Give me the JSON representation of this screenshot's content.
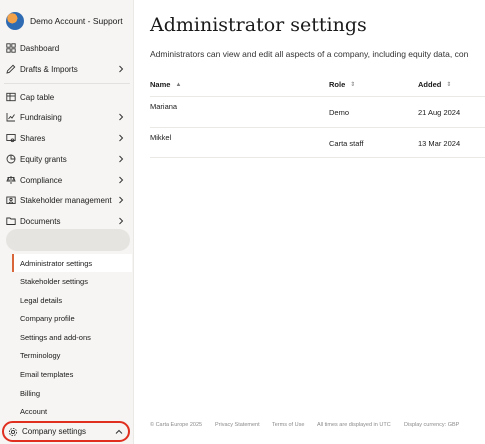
{
  "account": {
    "name": "Demo Account - Support"
  },
  "nav": {
    "dashboard": "Dashboard",
    "drafts": "Drafts & Imports",
    "cap_table": "Cap table",
    "fundraising": "Fundraising",
    "shares": "Shares",
    "equity_grants": "Equity grants",
    "compliance": "Compliance",
    "stakeholder_management": "Stakeholder management",
    "documents": "Documents"
  },
  "settings_menu": {
    "administrator": "Administrator settings",
    "stakeholder": "Stakeholder settings",
    "legal": "Legal details",
    "company_profile": "Company profile",
    "addons": "Settings and add-ons",
    "terminology": "Terminology",
    "email_templates": "Email templates",
    "billing": "Billing",
    "account": "Account"
  },
  "company_settings": {
    "label": "Company settings"
  },
  "page": {
    "title": "Administrator settings",
    "description": "Administrators can view and edit all aspects of a company, including equity data, con"
  },
  "table": {
    "headers": {
      "name": "Name",
      "role": "Role",
      "added": "Added"
    },
    "rows": [
      {
        "name": "Mariana",
        "role": "Demo",
        "added": "21 Aug 2024"
      },
      {
        "name": "Mikkel",
        "role": "Carta staff",
        "added": "13 Mar 2024"
      }
    ]
  },
  "footer": {
    "copyright": "© Carta Europe 2025",
    "privacy": "Privacy Statement",
    "terms": "Terms of Use",
    "utc": "All times are displayed in UTC",
    "currency": "Display currency: GBP"
  },
  "colors": {
    "accent": "#d9653b",
    "highlight": "#e02f1f"
  }
}
